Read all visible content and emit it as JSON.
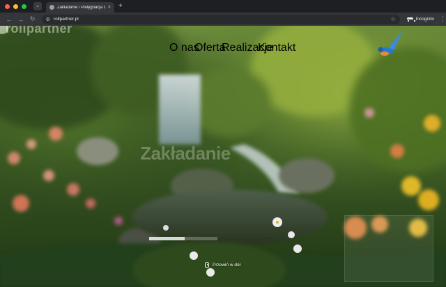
{
  "browser": {
    "tab_title": "Zakładanie i Pielęgnacja Ogr",
    "new_tab_label": "+",
    "close_label": "×",
    "url": "rollpartner.pl",
    "incognito_label": "Incognito"
  },
  "page": {
    "logo_text": "rollpartner",
    "nav": [
      {
        "label": "O nas"
      },
      {
        "label": "Oferta"
      },
      {
        "label": "Realizacje"
      },
      {
        "label": "Kontakt"
      }
    ],
    "hero_title": "Zakładanie",
    "slider_progress": 0.52,
    "scroll_hint": "Przewiń w dół"
  },
  "colors": {
    "tab_bg": "#35363a",
    "chrome_bg": "#1e1f22",
    "accent_white": "#ffffff"
  }
}
